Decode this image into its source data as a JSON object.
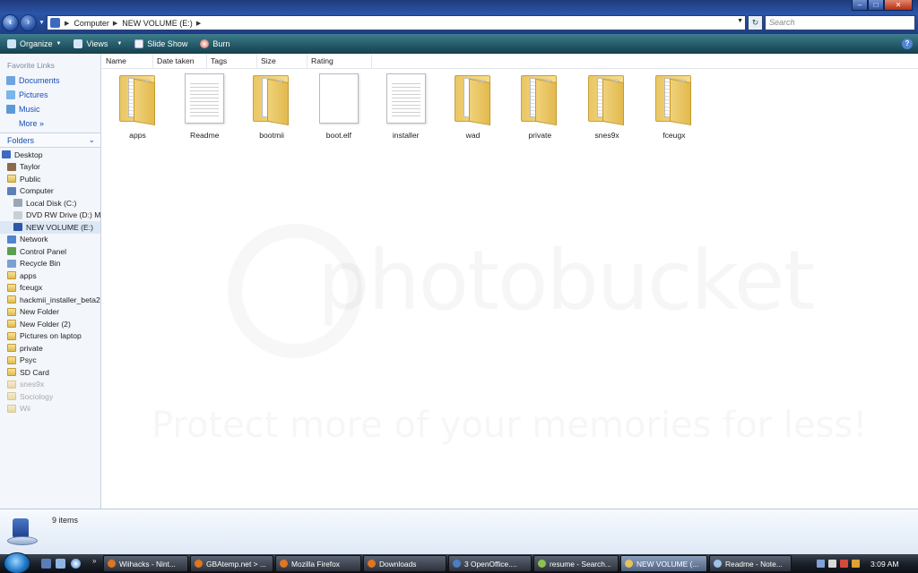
{
  "address": {
    "crumbs": [
      "Computer",
      "NEW VOLUME (E:)"
    ],
    "search_placeholder": "Search"
  },
  "toolbar": {
    "organize": "Organize",
    "views": "Views",
    "slideshow": "Slide Show",
    "burn": "Burn"
  },
  "sidebar": {
    "favorites_title": "Favorite Links",
    "favorites": [
      "Documents",
      "Pictures",
      "Music"
    ],
    "more": "More",
    "folders_title": "Folders",
    "tree": [
      {
        "label": "Desktop",
        "level": 0,
        "icon": "desktop-icon",
        "faded": false,
        "selected": false
      },
      {
        "label": "Taylor",
        "level": 1,
        "icon": "user-icon",
        "faded": false,
        "selected": false
      },
      {
        "label": "Public",
        "level": 1,
        "icon": "folder-icon",
        "faded": false,
        "selected": false
      },
      {
        "label": "Computer",
        "level": 1,
        "icon": "computer-icon",
        "faded": false,
        "selected": false
      },
      {
        "label": "Local Disk (C:)",
        "level": 2,
        "icon": "hard-drive-icon",
        "faded": false,
        "selected": false
      },
      {
        "label": "DVD RW Drive (D:) My",
        "level": 2,
        "icon": "dvd-drive-icon",
        "faded": false,
        "selected": false
      },
      {
        "label": "NEW VOLUME (E:)",
        "level": 2,
        "icon": "usb-drive-icon",
        "faded": false,
        "selected": true
      },
      {
        "label": "Network",
        "level": 1,
        "icon": "network-icon",
        "faded": false,
        "selected": false
      },
      {
        "label": "Control Panel",
        "level": 1,
        "icon": "control-panel-icon",
        "faded": false,
        "selected": false
      },
      {
        "label": "Recycle Bin",
        "level": 1,
        "icon": "recycle-bin-icon",
        "faded": false,
        "selected": false
      },
      {
        "label": "apps",
        "level": 1,
        "icon": "folder-icon",
        "faded": false,
        "selected": false
      },
      {
        "label": "fceugx",
        "level": 1,
        "icon": "folder-icon",
        "faded": false,
        "selected": false
      },
      {
        "label": "hackmii_installer_beta2",
        "level": 1,
        "icon": "folder-icon",
        "faded": false,
        "selected": false
      },
      {
        "label": "New Folder",
        "level": 1,
        "icon": "folder-icon",
        "faded": false,
        "selected": false
      },
      {
        "label": "New Folder (2)",
        "level": 1,
        "icon": "folder-icon",
        "faded": false,
        "selected": false
      },
      {
        "label": "Pictures on laptop",
        "level": 1,
        "icon": "folder-icon",
        "faded": false,
        "selected": false
      },
      {
        "label": "private",
        "level": 1,
        "icon": "folder-icon",
        "faded": false,
        "selected": false
      },
      {
        "label": "Psyc",
        "level": 1,
        "icon": "folder-icon",
        "faded": false,
        "selected": false
      },
      {
        "label": "SD Card",
        "level": 1,
        "icon": "folder-icon",
        "faded": false,
        "selected": false
      },
      {
        "label": "snes9x",
        "level": 1,
        "icon": "folder-icon",
        "faded": true,
        "selected": false
      },
      {
        "label": "Sociology",
        "level": 1,
        "icon": "folder-icon",
        "faded": true,
        "selected": false
      },
      {
        "label": "Wii",
        "level": 1,
        "icon": "folder-icon",
        "faded": true,
        "selected": false
      }
    ]
  },
  "columns": [
    "Name",
    "Date taken",
    "Tags",
    "Size",
    "Rating"
  ],
  "items": [
    {
      "label": "apps",
      "kind": "folder"
    },
    {
      "label": "Readme",
      "kind": "text-document"
    },
    {
      "label": "bootmii",
      "kind": "folder-open"
    },
    {
      "label": "boot.elf",
      "kind": "blank-document"
    },
    {
      "label": "installer",
      "kind": "text-document"
    },
    {
      "label": "wad",
      "kind": "folder-open"
    },
    {
      "label": "private",
      "kind": "folder"
    },
    {
      "label": "snes9x",
      "kind": "folder"
    },
    {
      "label": "fceugx",
      "kind": "folder"
    }
  ],
  "watermark": {
    "brand": "photobucket",
    "tagline": "Protect more of your memories for less!"
  },
  "details": {
    "count": "9 items"
  },
  "taskbar": {
    "tasks": [
      {
        "label": "Wiihacks - Nint...",
        "icon": "firefox-icon"
      },
      {
        "label": "GBAtemp.net > ...",
        "icon": "firefox-icon"
      },
      {
        "label": "Mozilla Firefox",
        "icon": "firefox-icon"
      },
      {
        "label": "Downloads",
        "icon": "firefox-icon"
      },
      {
        "label": "3 OpenOffice....",
        "icon": "openoffice-icon"
      },
      {
        "label": "resume - Search...",
        "icon": "search-icon"
      },
      {
        "label": "NEW VOLUME (...",
        "icon": "folder-icon"
      },
      {
        "label": "Readme - Note...",
        "icon": "notepad-icon"
      }
    ],
    "clock": "3:09 AM"
  },
  "colors": {
    "title_bar": "#2b55a8",
    "toolbar": "#275e6d",
    "link": "#1a4fb5",
    "folder": "#e9c765"
  }
}
